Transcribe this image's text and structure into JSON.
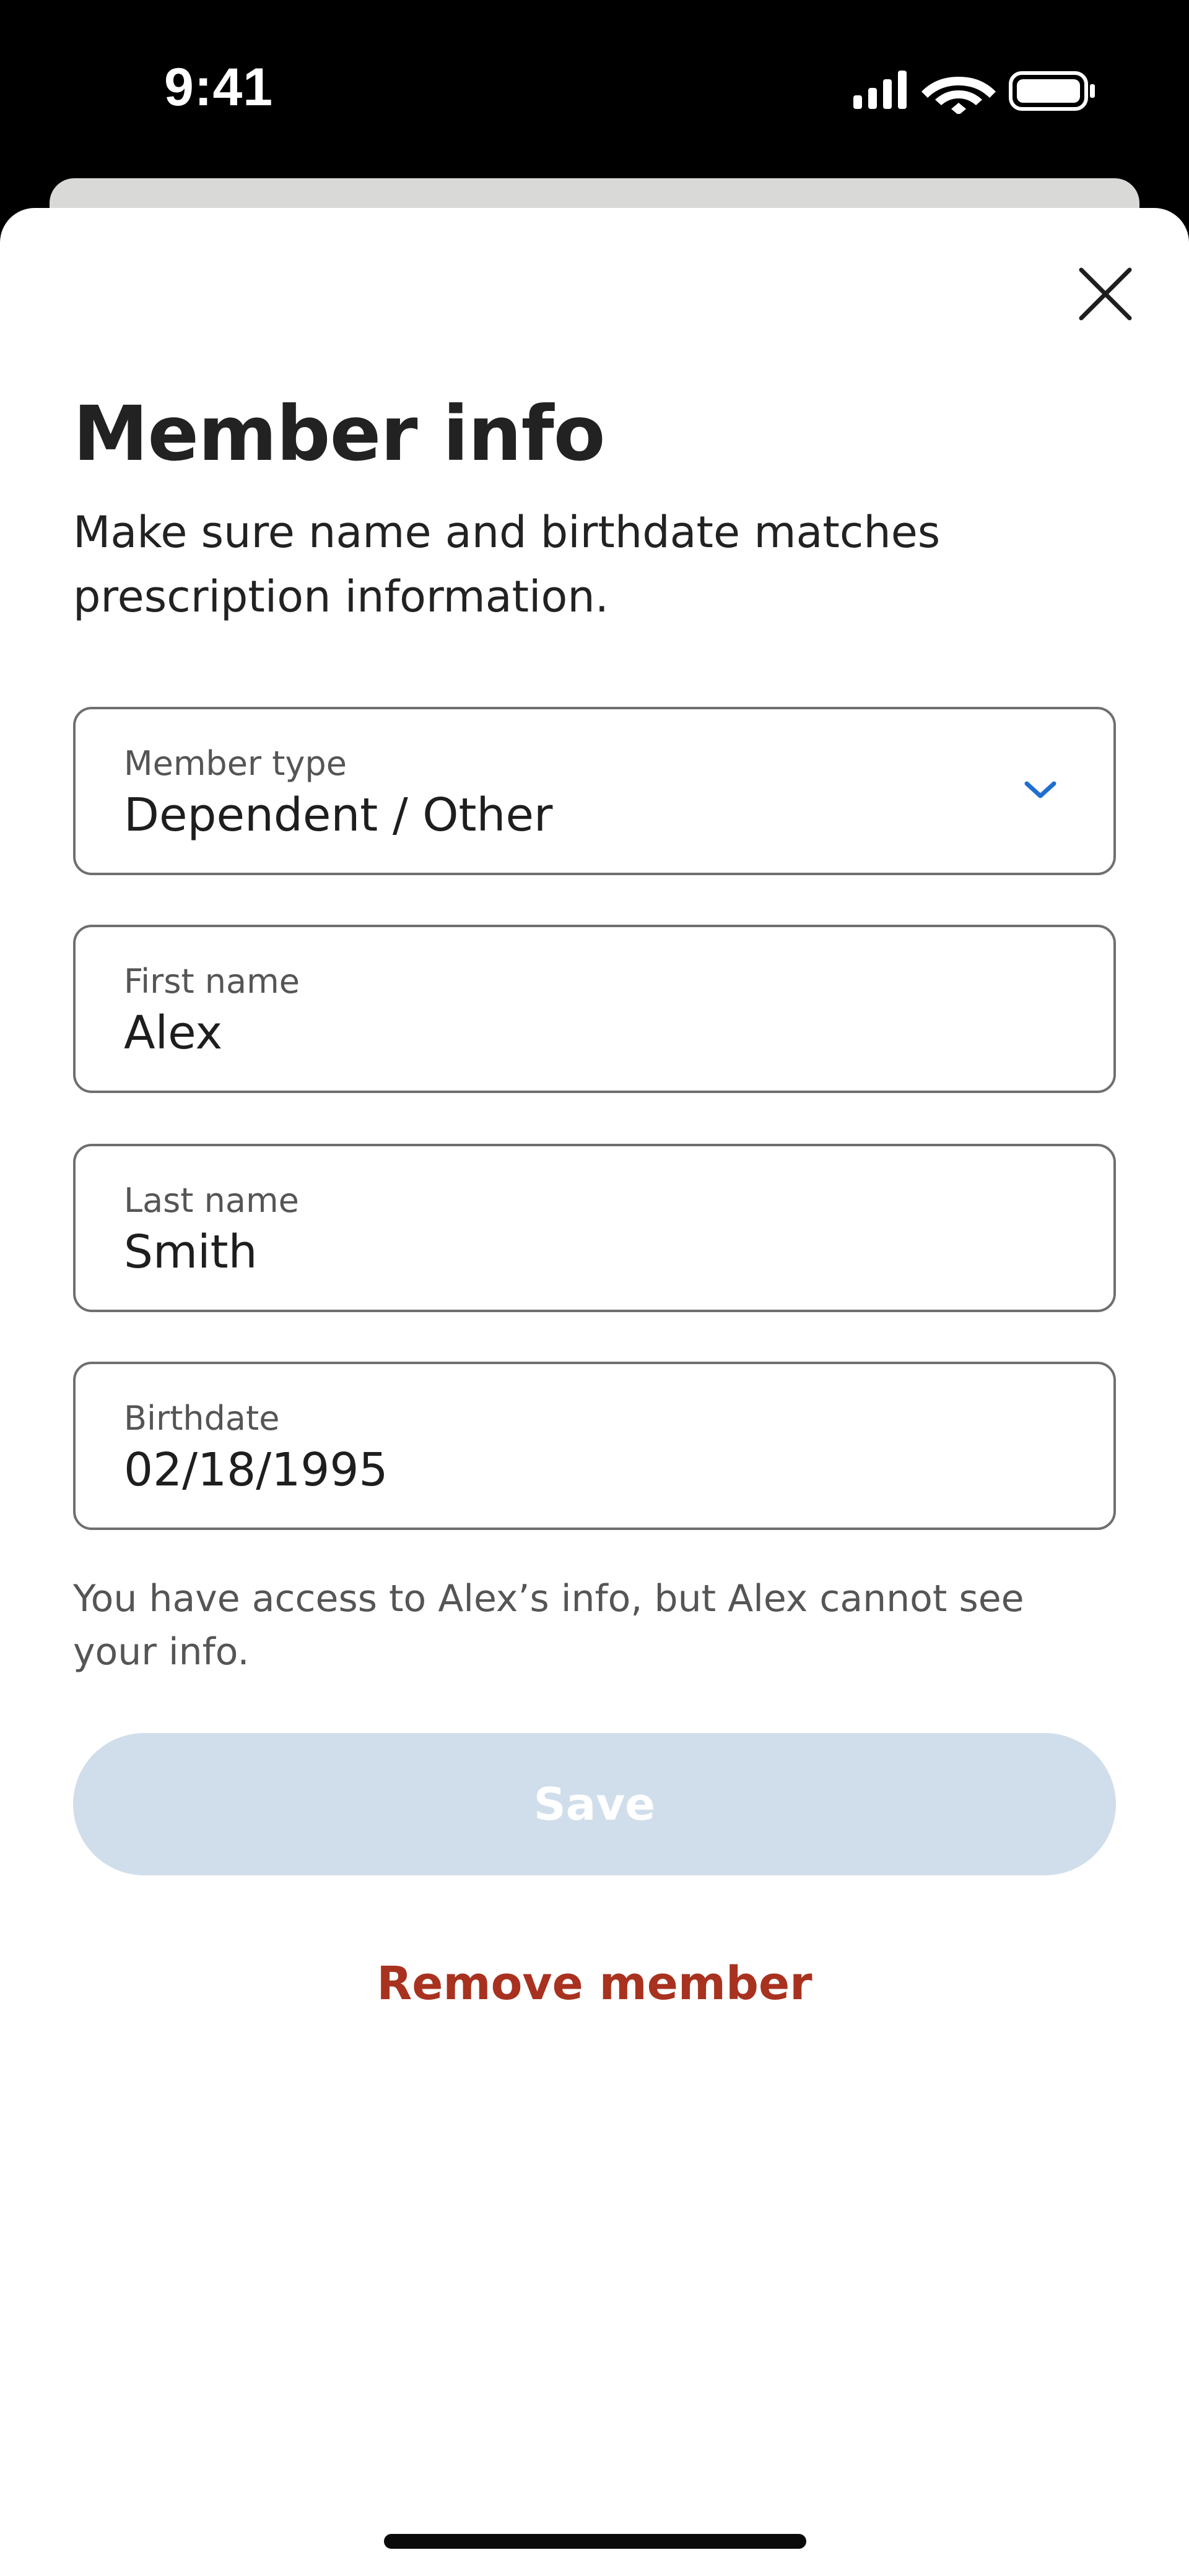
{
  "status_bar": {
    "time": "9:41",
    "icons": [
      "cellular-signal-icon",
      "wifi-icon",
      "battery-icon"
    ]
  },
  "sheet": {
    "close_icon": "close-icon",
    "title": "Member info",
    "subtitle": "Make sure name and birthdate matches prescription information."
  },
  "form": {
    "member_type": {
      "label": "Member type",
      "value": "Dependent / Other",
      "icon": "chevron-down-icon"
    },
    "first_name": {
      "label": "First name",
      "value": "Alex"
    },
    "last_name": {
      "label": "Last name",
      "value": "Smith"
    },
    "birthdate": {
      "label": "Birthdate",
      "value": "02/18/1995"
    }
  },
  "note": "You have access to Alex’s info, but Alex cannot see your info.",
  "actions": {
    "save_label": "Save",
    "remove_label": "Remove member"
  },
  "colors": {
    "accent_blue": "#1f6fd1",
    "save_disabled_bg": "#d0deec",
    "remove_red": "#a8321f",
    "text_dark": "#222222",
    "text_muted": "#555555",
    "border": "#6f6f6f"
  }
}
